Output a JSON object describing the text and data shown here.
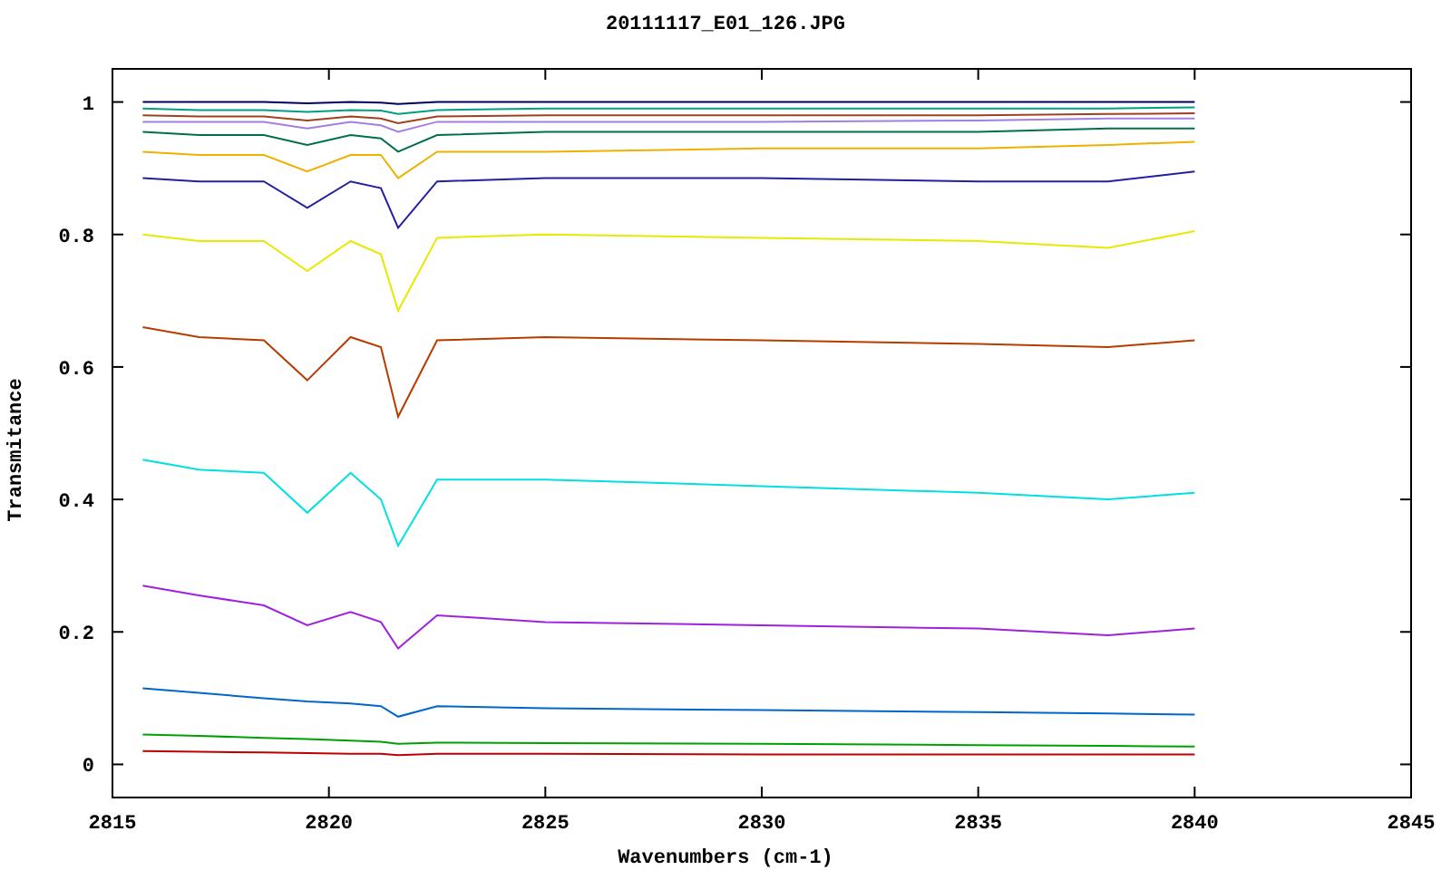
{
  "chart_data": {
    "type": "line",
    "title": "20111117_E01_126.JPG",
    "xlabel": "Wavenumbers (cm-1)",
    "ylabel": "Transmitance",
    "x": [
      2815.7,
      2817,
      2818.5,
      2819.5,
      2820.5,
      2821.2,
      2821.6,
      2822.5,
      2825,
      2830,
      2835,
      2838,
      2840
    ],
    "xlim": [
      2815,
      2845
    ],
    "ylim": [
      -0.05,
      1.05
    ],
    "xticks": [
      2815,
      2820,
      2825,
      2830,
      2835,
      2840,
      2845
    ],
    "yticks": [
      {
        "value": 0,
        "label": "0"
      },
      {
        "value": 0.2,
        "label": "0.2"
      },
      {
        "value": 0.4,
        "label": "0.4"
      },
      {
        "value": 0.6,
        "label": "0.6"
      },
      {
        "value": 0.8,
        "label": "0.8"
      },
      {
        "value": 1,
        "label": "1"
      }
    ],
    "series": [
      {
        "color": "#c00000",
        "values": [
          0.02,
          0.019,
          0.018,
          0.017,
          0.016,
          0.016,
          0.014,
          0.016,
          0.016,
          0.015,
          0.015,
          0.015,
          0.015
        ]
      },
      {
        "color": "#00a000",
        "values": [
          0.045,
          0.043,
          0.04,
          0.038,
          0.036,
          0.034,
          0.031,
          0.033,
          0.032,
          0.031,
          0.029,
          0.028,
          0.027
        ]
      },
      {
        "color": "#0066cc",
        "values": [
          0.115,
          0.108,
          0.1,
          0.095,
          0.092,
          0.088,
          0.072,
          0.088,
          0.085,
          0.082,
          0.079,
          0.077,
          0.075
        ]
      },
      {
        "color": "#a020e0",
        "values": [
          0.27,
          0.255,
          0.24,
          0.21,
          0.23,
          0.215,
          0.175,
          0.225,
          0.215,
          0.21,
          0.205,
          0.195,
          0.205
        ]
      },
      {
        "color": "#00e0e0",
        "values": [
          0.46,
          0.445,
          0.44,
          0.38,
          0.44,
          0.4,
          0.33,
          0.43,
          0.43,
          0.42,
          0.41,
          0.4,
          0.41
        ]
      },
      {
        "color": "#b83c00",
        "values": [
          0.66,
          0.645,
          0.64,
          0.58,
          0.645,
          0.63,
          0.525,
          0.64,
          0.645,
          0.64,
          0.635,
          0.63,
          0.64
        ]
      },
      {
        "color": "#e8e800",
        "values": [
          0.8,
          0.79,
          0.79,
          0.745,
          0.79,
          0.77,
          0.685,
          0.795,
          0.8,
          0.795,
          0.79,
          0.78,
          0.805
        ]
      },
      {
        "color": "#2020a0",
        "values": [
          0.885,
          0.88,
          0.88,
          0.84,
          0.88,
          0.87,
          0.81,
          0.88,
          0.885,
          0.885,
          0.88,
          0.88,
          0.895
        ]
      },
      {
        "color": "#f0b000",
        "values": [
          0.925,
          0.92,
          0.92,
          0.895,
          0.92,
          0.92,
          0.885,
          0.925,
          0.925,
          0.93,
          0.93,
          0.935,
          0.94
        ]
      },
      {
        "color": "#00704a",
        "values": [
          0.955,
          0.95,
          0.95,
          0.935,
          0.95,
          0.945,
          0.925,
          0.95,
          0.955,
          0.955,
          0.955,
          0.96,
          0.96
        ]
      },
      {
        "color": "#a080e0",
        "values": [
          0.97,
          0.97,
          0.97,
          0.96,
          0.97,
          0.965,
          0.955,
          0.97,
          0.97,
          0.97,
          0.972,
          0.975,
          0.975
        ]
      },
      {
        "color": "#a04020",
        "values": [
          0.98,
          0.978,
          0.978,
          0.972,
          0.978,
          0.975,
          0.968,
          0.978,
          0.98,
          0.98,
          0.98,
          0.982,
          0.983
        ]
      },
      {
        "color": "#00a080",
        "values": [
          0.99,
          0.988,
          0.988,
          0.985,
          0.988,
          0.987,
          0.982,
          0.988,
          0.99,
          0.99,
          0.99,
          0.99,
          0.992
        ]
      },
      {
        "color": "#000060",
        "values": [
          1,
          1,
          1,
          0.998,
          1,
          0.999,
          0.997,
          1,
          1,
          1,
          1,
          1,
          1
        ]
      }
    ]
  }
}
